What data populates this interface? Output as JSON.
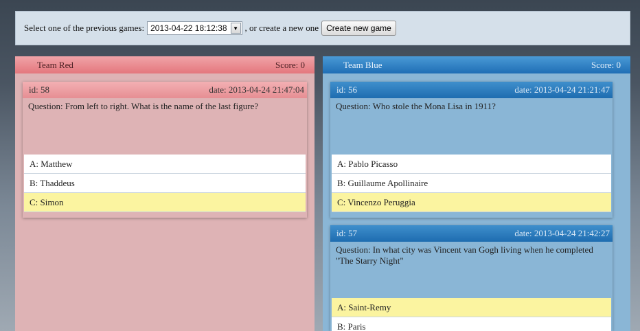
{
  "topbar": {
    "select_label": "Select one of the previous games:",
    "selected_game": "2013-04-22 18:12:38",
    "or_text": ", or create a new one",
    "create_button": "Create new game"
  },
  "teams": [
    {
      "name": "Team Red",
      "score": "Score: 0",
      "color": "#e4777d",
      "cards": [
        {
          "id": "id: 58",
          "date": "date: 2013-04-24 21:47:04",
          "question": "Question: From left to right. What is the name of the last figure?",
          "answers": [
            "A: Matthew",
            "B: Thaddeus",
            "C: Simon"
          ],
          "correct_index": 2
        }
      ]
    },
    {
      "name": "Team Blue",
      "score": "Score: 0",
      "color": "#1f6eb5",
      "cards": [
        {
          "id": "id: 56",
          "date": "date: 2013-04-24 21:21:47",
          "question": "Question: Who stole the Mona Lisa in 1911?",
          "answers": [
            "A: Pablo Picasso",
            "B: Guillaume Apollinaire",
            "C: Vincenzo Peruggia"
          ],
          "correct_index": 2
        },
        {
          "id": "id: 57",
          "date": "date: 2013-04-24 21:42:27",
          "question": "Question: In what city was Vincent van Gogh living when he completed \"The Starry Night\"",
          "answers": [
            "A: Saint-Remy",
            "B: Paris"
          ],
          "correct_index": 0
        }
      ]
    }
  ],
  "colors": {
    "highlight": "#fbf4a0",
    "red_panel": "#deb3b5",
    "blue_panel": "#8ab6d6"
  }
}
